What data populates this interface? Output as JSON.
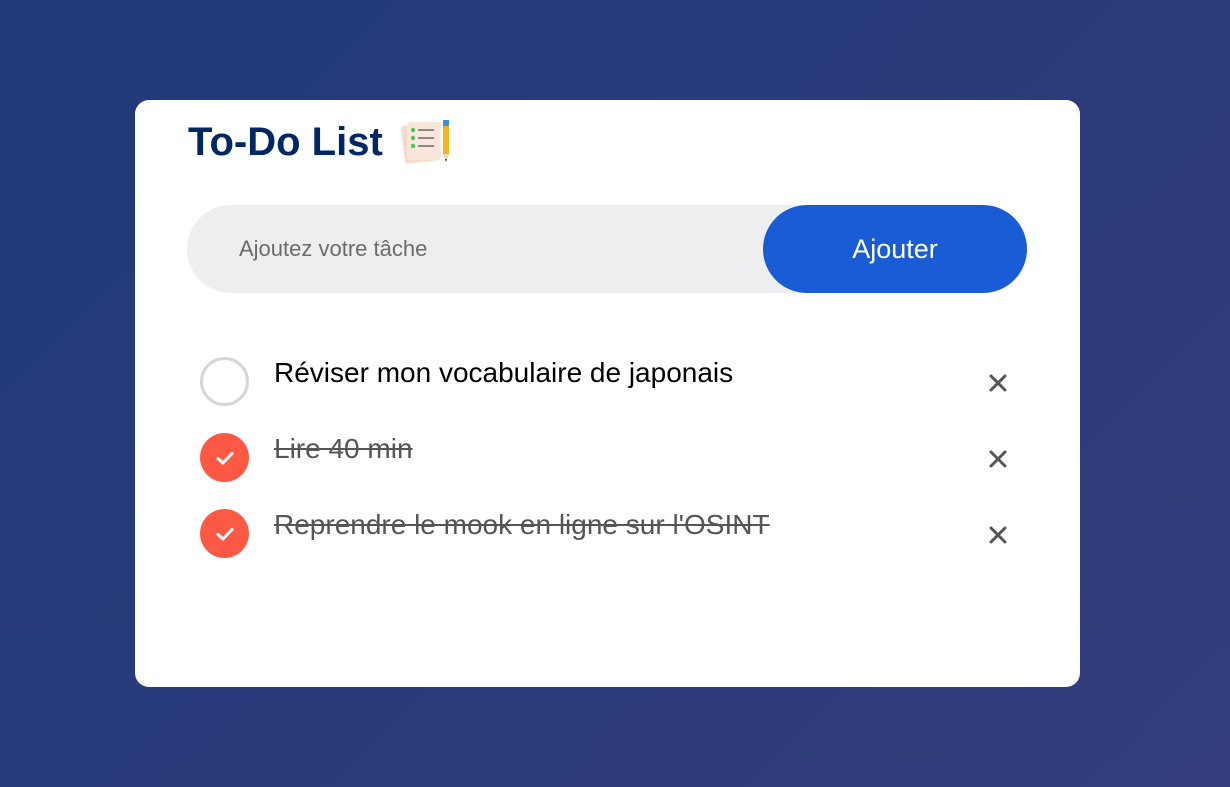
{
  "header": {
    "title": "To-Do List",
    "title_icon": "notepad-pencil-icon"
  },
  "add_form": {
    "input_placeholder": "Ajoutez votre tâche",
    "input_value": "",
    "button_label": "Ajouter"
  },
  "tasks": [
    {
      "text": "Réviser mon vocabulaire de japonais",
      "done": false
    },
    {
      "text": "Lire 40 min",
      "done": true
    },
    {
      "text": "Reprendre le mook en ligne sur l'OSINT",
      "done": true
    }
  ],
  "icons": {
    "check": "checkmark-icon",
    "delete": "close-icon"
  },
  "colors": {
    "background": "#233a7a",
    "title": "#002765",
    "accent_button": "#1a5bd6",
    "check_done": "#ff5945",
    "input_bg": "#edeef0"
  }
}
